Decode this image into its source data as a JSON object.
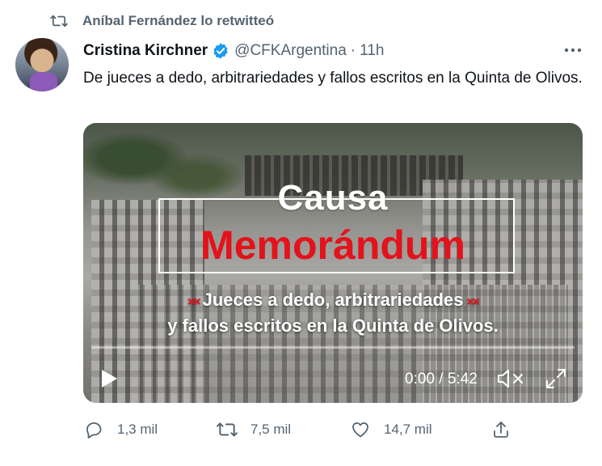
{
  "retweet_header": {
    "text": "Aníbal Fernández lo retwitteó",
    "icon": "retweet-icon"
  },
  "author": {
    "name": "Cristina Kirchner",
    "verified": true,
    "handle": "@CFKArgentina",
    "separator": "·",
    "time": "11h"
  },
  "tweet": {
    "text": "De jueces a dedo, arbitrariedades y fallos escritos en la Quinta de Olivos."
  },
  "video": {
    "title_line1": "Causa",
    "title_line2": "Memorándum",
    "subtitle_line1": "Jueces a dedo, arbitrariedades",
    "subtitle_line2": "y fallos escritos en la Quinta de Olivos.",
    "marks": "××",
    "time_display": "0:00 / 5:42",
    "progress_fraction": 0.0
  },
  "actions": {
    "reply_count": "1,3 mil",
    "retweet_count": "7,5 mil",
    "like_count": "14,7 mil"
  },
  "colors": {
    "secondary_text": "#536471",
    "verified_blue": "#1d9bf0",
    "video_title_red": "#e3121b"
  }
}
